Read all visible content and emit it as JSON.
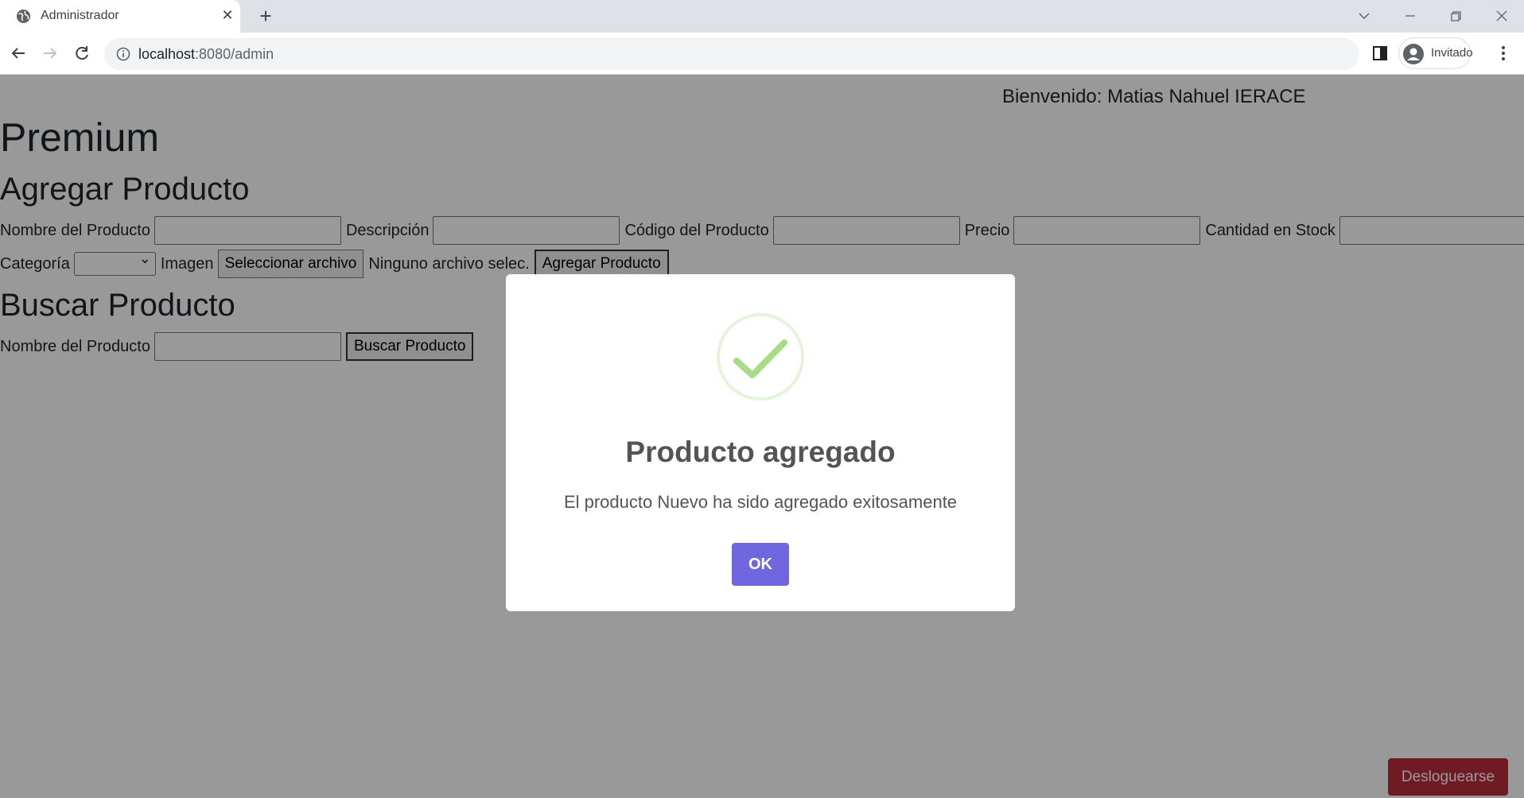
{
  "browser": {
    "tab_title": "Administrador",
    "url_host": "localhost",
    "url_rest": ":8080/admin",
    "profile_label": "Invitado"
  },
  "page": {
    "welcome": "Bienvenido: Matias Nahuel IERACE",
    "heading_premium": "Premium",
    "add_section": {
      "title": "Agregar Producto",
      "fields": {
        "name_label": "Nombre del Producto",
        "name_value": "",
        "description_label": "Descripción",
        "description_value": "",
        "code_label": "Código del Producto",
        "code_value": "",
        "price_label": "Precio",
        "price_value": "",
        "stock_label": "Cantidad en Stock",
        "stock_value": "",
        "category_label": "Categoría",
        "category_selected": "",
        "image_label": "Imagen",
        "file_button": "Seleccionar archivo",
        "file_status": "Ninguno archivo selec."
      },
      "submit": "Agregar Producto"
    },
    "search_section": {
      "title": "Buscar Producto",
      "name_label": "Nombre del Producto",
      "name_value": "",
      "submit": "Buscar Producto"
    },
    "logout": "Desloguearse"
  },
  "modal": {
    "icon": "success-check-icon",
    "title": "Producto agregado",
    "text": "El producto Nuevo ha sido agregado exitosamente",
    "ok": "OK"
  },
  "colors": {
    "ok_button": "#7066e0",
    "logout_button": "#bb2d3b",
    "success_icon": "#a5dc86"
  }
}
